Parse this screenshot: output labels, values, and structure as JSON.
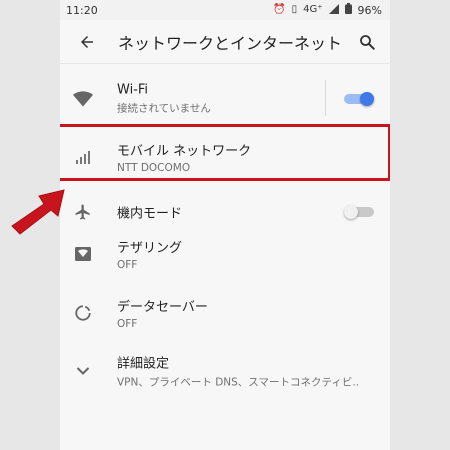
{
  "status": {
    "time": "11:20",
    "network": "4G⁺",
    "battery": "96%"
  },
  "appbar": {
    "title": "ネットワークとインターネット"
  },
  "items": [
    {
      "label": "Wi-Fi",
      "sub": "接続されていません",
      "icon": "wifi-icon",
      "toggle": "on"
    },
    {
      "label": "モバイル ネットワーク",
      "sub": "NTT DOCOMO",
      "icon": "cellular-signal-icon"
    },
    {
      "label": "機内モード",
      "sub": "",
      "icon": "airplane-icon",
      "toggle": "off"
    },
    {
      "label": "テザリング",
      "sub": "OFF",
      "icon": "hotspot-icon"
    },
    {
      "label": "データセーバー",
      "sub": "OFF",
      "icon": "data-saver-icon"
    },
    {
      "label": "詳細設定",
      "sub": "VPN、プライベート DNS、スマートコネクティビ..",
      "icon": "chevron-down-icon"
    }
  ],
  "colors": {
    "accent": "#3f78e8",
    "highlight": "#c8141c",
    "arrow": "#c8141c"
  }
}
